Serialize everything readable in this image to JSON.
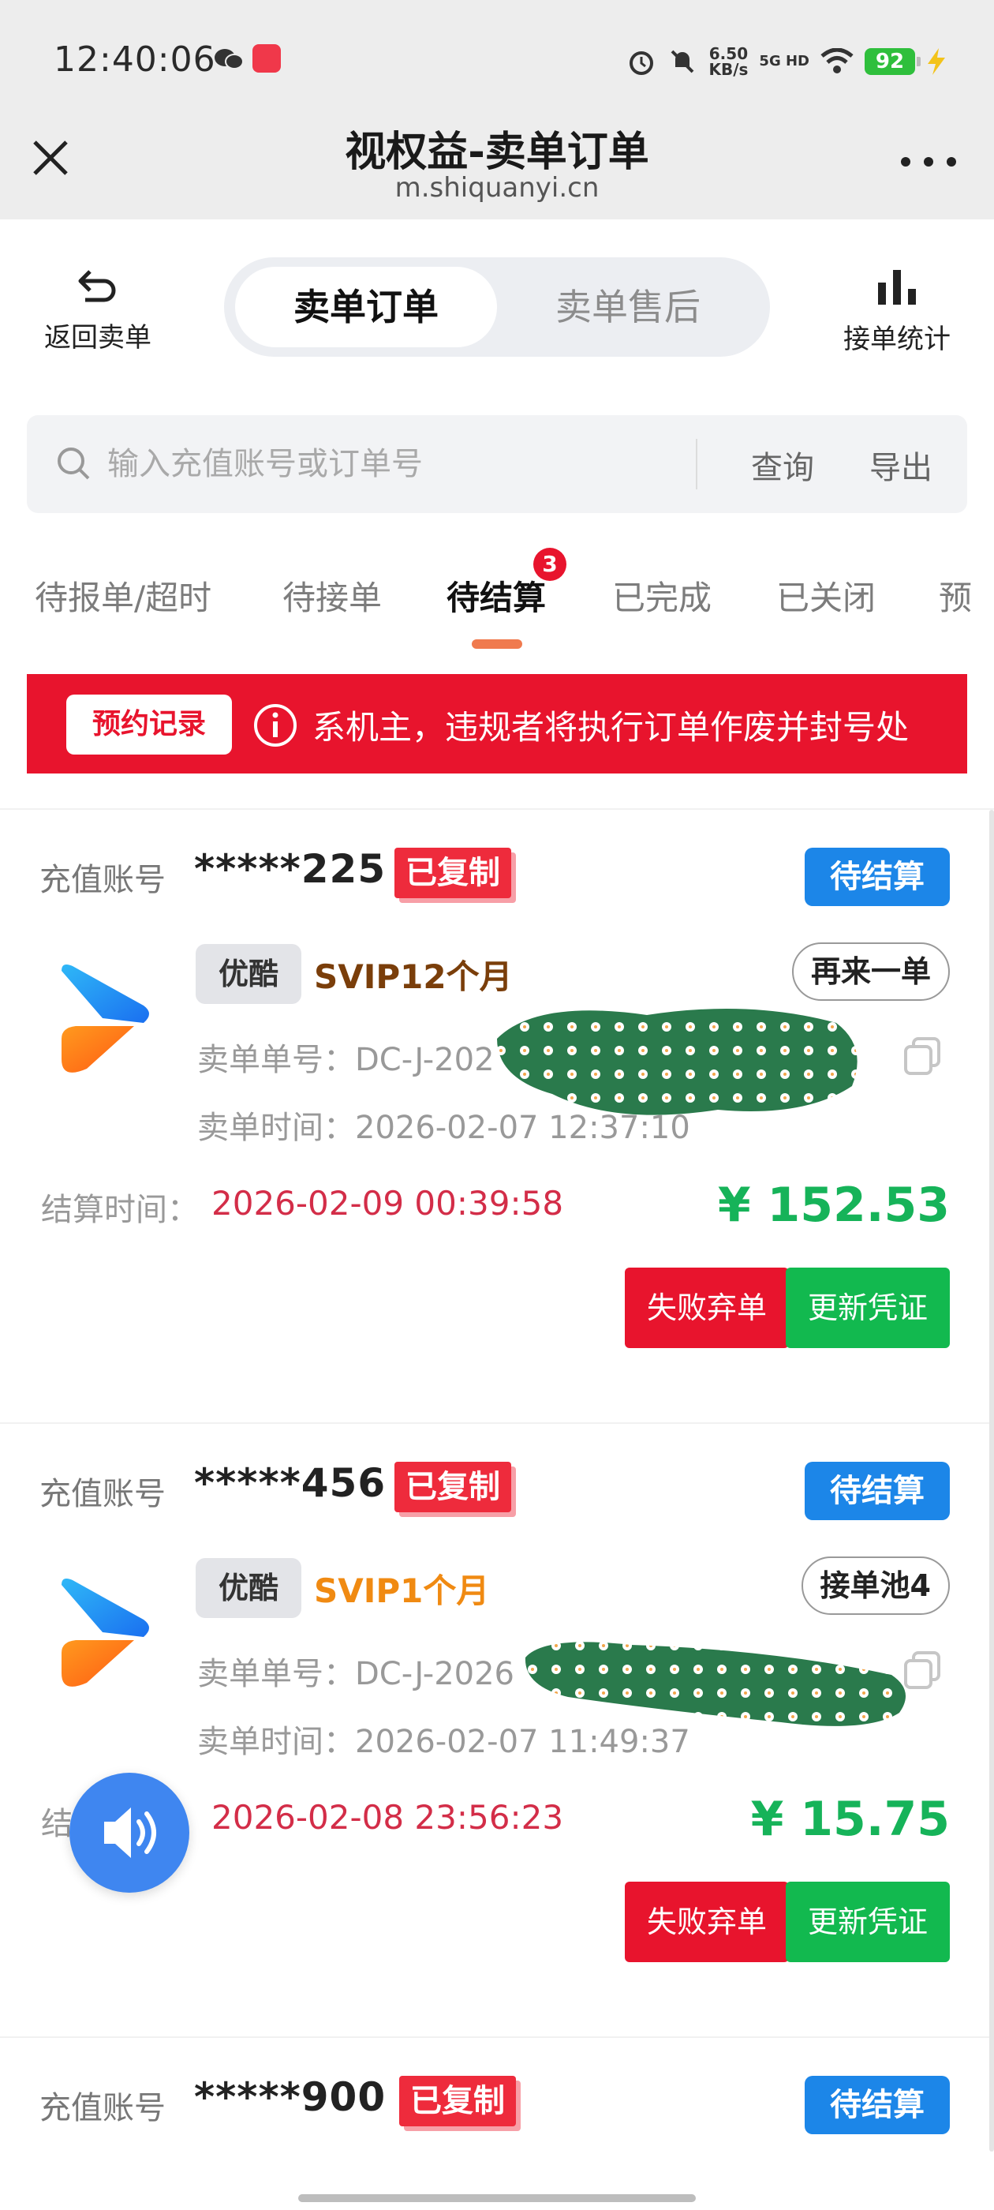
{
  "status_bar": {
    "time": "12:40:06",
    "net_speed": "6.50",
    "net_speed_unit": "KB/s",
    "network": "5G HD",
    "battery": "92"
  },
  "titlebar": {
    "title": "视权益-卖单订单",
    "url": "m.shiquanyi.cn"
  },
  "actions": {
    "back": "返回卖单",
    "stats": "接单统计"
  },
  "segment": {
    "active": "卖单订单",
    "inactive": "卖单售后"
  },
  "search": {
    "placeholder": "输入充值账号或订单号",
    "query": "查询",
    "export": "导出"
  },
  "status_tabs": {
    "t1": "待报单/超时",
    "t2": "待接单",
    "t3": "待结算",
    "t3_badge": "3",
    "t4": "已完成",
    "t5": "已关闭",
    "t6": "预"
  },
  "notice": {
    "record": "预约记录",
    "text": "系机主，违规者将执行订单作废并封号处"
  },
  "labels": {
    "account": "充值账号",
    "sn_prefix": "卖单单号：",
    "time_prefix": "卖单时间：",
    "settle_prefix": "结算时间：",
    "copied": "已复制",
    "fail": "失败弃单",
    "update": "更新凭证"
  },
  "orders": [
    {
      "account": "*****225",
      "status": "待结算",
      "brand": "优酷",
      "product": "SVIP12个月",
      "product_color": "#7a3e0a",
      "tag": "再来一单",
      "order_no": "DC-J-202",
      "order_time": "2026-02-07 12:37:10",
      "settle_time": "2026-02-09 00:39:58",
      "price": "¥ 152.53"
    },
    {
      "account": "*****456",
      "status": "待结算",
      "brand": "优酷",
      "product": "SVIP1个月",
      "product_color": "#f08a12",
      "tag": "接单池4",
      "order_no": "DC-J-2026",
      "order_time": "2026-02-07 11:49:37",
      "settle_time": "2026-02-08 23:56:23",
      "price": "¥ 15.75"
    },
    {
      "account": "*****900",
      "status": "待结算"
    }
  ],
  "icons": {
    "close": "close-icon",
    "more": "more-icon",
    "back": "undo-icon",
    "stats": "bar-chart-icon",
    "search": "search-icon",
    "info": "info-icon",
    "copy": "copy-icon",
    "sound": "speaker-icon",
    "youku": "youku-logo"
  },
  "colors": {
    "accent_red": "#e8142d",
    "status_blue": "#1c86e8",
    "price_green": "#16b359",
    "update_green": "#12b94f",
    "settle_red": "#d32d48"
  }
}
